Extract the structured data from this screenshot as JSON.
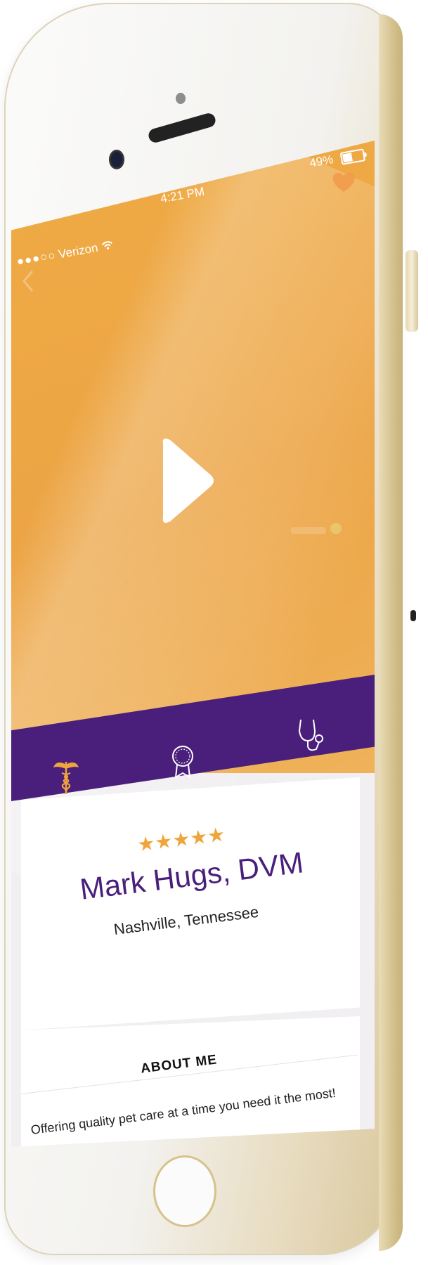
{
  "status_bar": {
    "carrier": "Verizon",
    "time": "4:21 PM",
    "battery": "49%"
  },
  "video": {
    "play_icon": "play-icon",
    "back_icon": "chevron-left-icon",
    "favorite_icon": "heart-icon"
  },
  "tabs": [
    {
      "icon": "caduceus-icon",
      "selected": true
    },
    {
      "icon": "award-ribbon-icon",
      "selected": false
    },
    {
      "icon": "stethoscope-icon",
      "selected": false
    }
  ],
  "profile": {
    "rating": 5,
    "stars_text": "★★★★★",
    "name": "Mark Hugs, DVM",
    "location": "Nashville, Tennessee"
  },
  "about": {
    "heading": "ABOUT ME",
    "text": "Offering quality pet care at a time you need it the most!"
  },
  "colors": {
    "accent_orange": "#eca444",
    "brand_purple": "#4a1f7c",
    "star_color": "#f0a43c"
  }
}
